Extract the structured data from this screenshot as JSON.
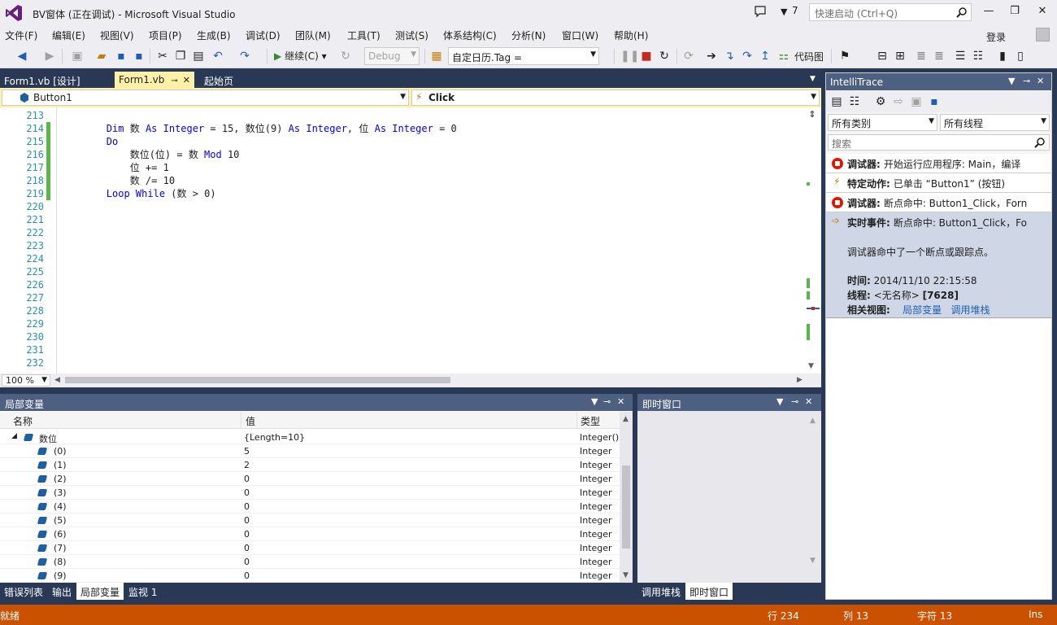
{
  "window": {
    "title": "BV窗体 (正在调试) - Microsoft Visual Studio",
    "filter_count": "7",
    "quick_launch_placeholder": "快速启动 (Ctrl+Q)",
    "accent_color": "#68217a"
  },
  "menu": {
    "items": [
      "文件(F)",
      "编辑(E)",
      "视图(V)",
      "项目(P)",
      "生成(B)",
      "调试(D)",
      "团队(M)",
      "工具(T)",
      "测试(S)",
      "体系结构(C)",
      "分析(N)",
      "窗口(W)",
      "帮助(H)"
    ],
    "login": "登录"
  },
  "toolbar": {
    "continue_label": "继续(C)",
    "config": "Debug",
    "expression": "自定日历.Tag =",
    "codemap_label": "代码图"
  },
  "doc_tabs": [
    {
      "label": "Form1.vb [设计]",
      "active": false
    },
    {
      "label": "Form1.vb",
      "active": true
    },
    {
      "label": "起始页",
      "active": false
    }
  ],
  "navbar": {
    "object": "Button1",
    "event": "Click"
  },
  "editor": {
    "line_numbers": [
      "213",
      "214",
      "215",
      "216",
      "217",
      "218",
      "219",
      "220",
      "221",
      "222",
      "223",
      "224",
      "225",
      "226",
      "227",
      "228",
      "229",
      "230",
      "231",
      "232"
    ],
    "code": {
      "l214_dim": "Dim",
      "l214_a": " 数 ",
      "l214_as1": "As",
      "l214_int1": " Integer",
      "l214_b": " = 15, 数位(9) ",
      "l214_as2": "As",
      "l214_int2": " Integer",
      "l214_c": ", 位 ",
      "l214_as3": "As",
      "l214_int3": " Integer",
      "l214_d": " = 0",
      "l215_do": "Do",
      "l216_a": "    数位(位) = 数 ",
      "l216_mod": "Mod",
      "l216_b": " 10",
      "l217": "    位 += 1",
      "l218": "    数 /= 10",
      "l219_loop": "Loop",
      "l219_while": " While",
      "l219_rest": " (数 > 0)"
    },
    "zoom": "100 %"
  },
  "locals": {
    "title": "局部变量",
    "columns": {
      "name": "名称",
      "value": "值",
      "type": "类型"
    },
    "root": {
      "name": "数位",
      "value": "{Length=10}",
      "type": "Integer()"
    },
    "items": [
      {
        "name": "(0)",
        "value": "5",
        "type": "Integer"
      },
      {
        "name": "(1)",
        "value": "2",
        "type": "Integer"
      },
      {
        "name": "(2)",
        "value": "0",
        "type": "Integer"
      },
      {
        "name": "(3)",
        "value": "0",
        "type": "Integer"
      },
      {
        "name": "(4)",
        "value": "0",
        "type": "Integer"
      },
      {
        "name": "(5)",
        "value": "0",
        "type": "Integer"
      },
      {
        "name": "(6)",
        "value": "0",
        "type": "Integer"
      },
      {
        "name": "(7)",
        "value": "0",
        "type": "Integer"
      },
      {
        "name": "(8)",
        "value": "0",
        "type": "Integer"
      },
      {
        "name": "(9)",
        "value": "0",
        "type": "Integer"
      }
    ]
  },
  "bottom_left_tabs": [
    "错误列表",
    "输出",
    "局部变量",
    "监视 1"
  ],
  "immediate": {
    "title": "即时窗口",
    "tabs": [
      "调用堆栈",
      "即时窗口"
    ]
  },
  "intellitrace": {
    "title": "IntelliTrace",
    "category_filter": "所有类别",
    "thread_filter": "所有线程",
    "search_placeholder": "搜索",
    "events": [
      {
        "kind": "调试器:",
        "text": "开始运行应用程序: Main，编译"
      },
      {
        "kind": "特定动作:",
        "text": "已单击 “Button1” (按钮)"
      },
      {
        "kind": "调试器:",
        "text": "断点命中: Button1_Click，Forn"
      },
      {
        "kind": "实时事件:",
        "text": "断点命中: Button1_Click，Fo"
      }
    ],
    "detail": {
      "description": "调试器命中了一个断点或跟踪点。",
      "time_label": "时间:",
      "time_value": "2014/11/10 22:15:58",
      "thread_label": "线程:",
      "thread_value": "<无名称>",
      "thread_id": "[7628]",
      "views_label": "相关视图:",
      "view_locals": "局部变量",
      "view_callstack": "调用堆栈"
    }
  },
  "status": {
    "ready": "就绪",
    "line": "行 234",
    "col": "列 13",
    "char": "字符 13",
    "mode": "Ins",
    "color": "#ca5100"
  }
}
